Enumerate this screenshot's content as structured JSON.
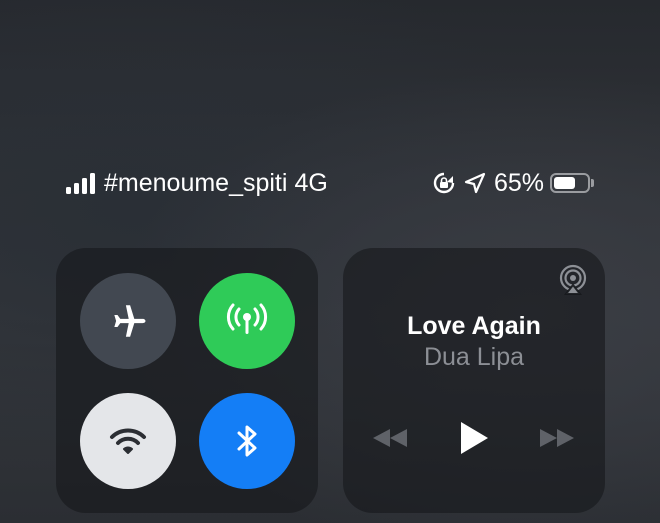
{
  "status_bar": {
    "carrier": "#menoume_spiti",
    "network": "4G",
    "battery_percent": "65%",
    "battery_level": 0.65,
    "icons": [
      "cellular-signal-icon",
      "rotation-lock-icon",
      "location-arrow-icon",
      "battery-icon"
    ]
  },
  "connectivity": {
    "airplane_mode": {
      "icon": "airplane-icon",
      "state": "off",
      "color": "#424851"
    },
    "cellular_data": {
      "icon": "cellular-antenna-icon",
      "state": "on",
      "color": "#2fcb58"
    },
    "wifi": {
      "icon": "wifi-icon",
      "state": "on",
      "color": "#e4e6e9"
    },
    "bluetooth": {
      "icon": "bluetooth-icon",
      "state": "on",
      "color": "#147ef6"
    }
  },
  "now_playing": {
    "title": "Love Again",
    "artist": "Dua Lipa",
    "icons": [
      "airplay-icon",
      "rewind-icon",
      "play-icon",
      "fast-forward-icon"
    ]
  }
}
